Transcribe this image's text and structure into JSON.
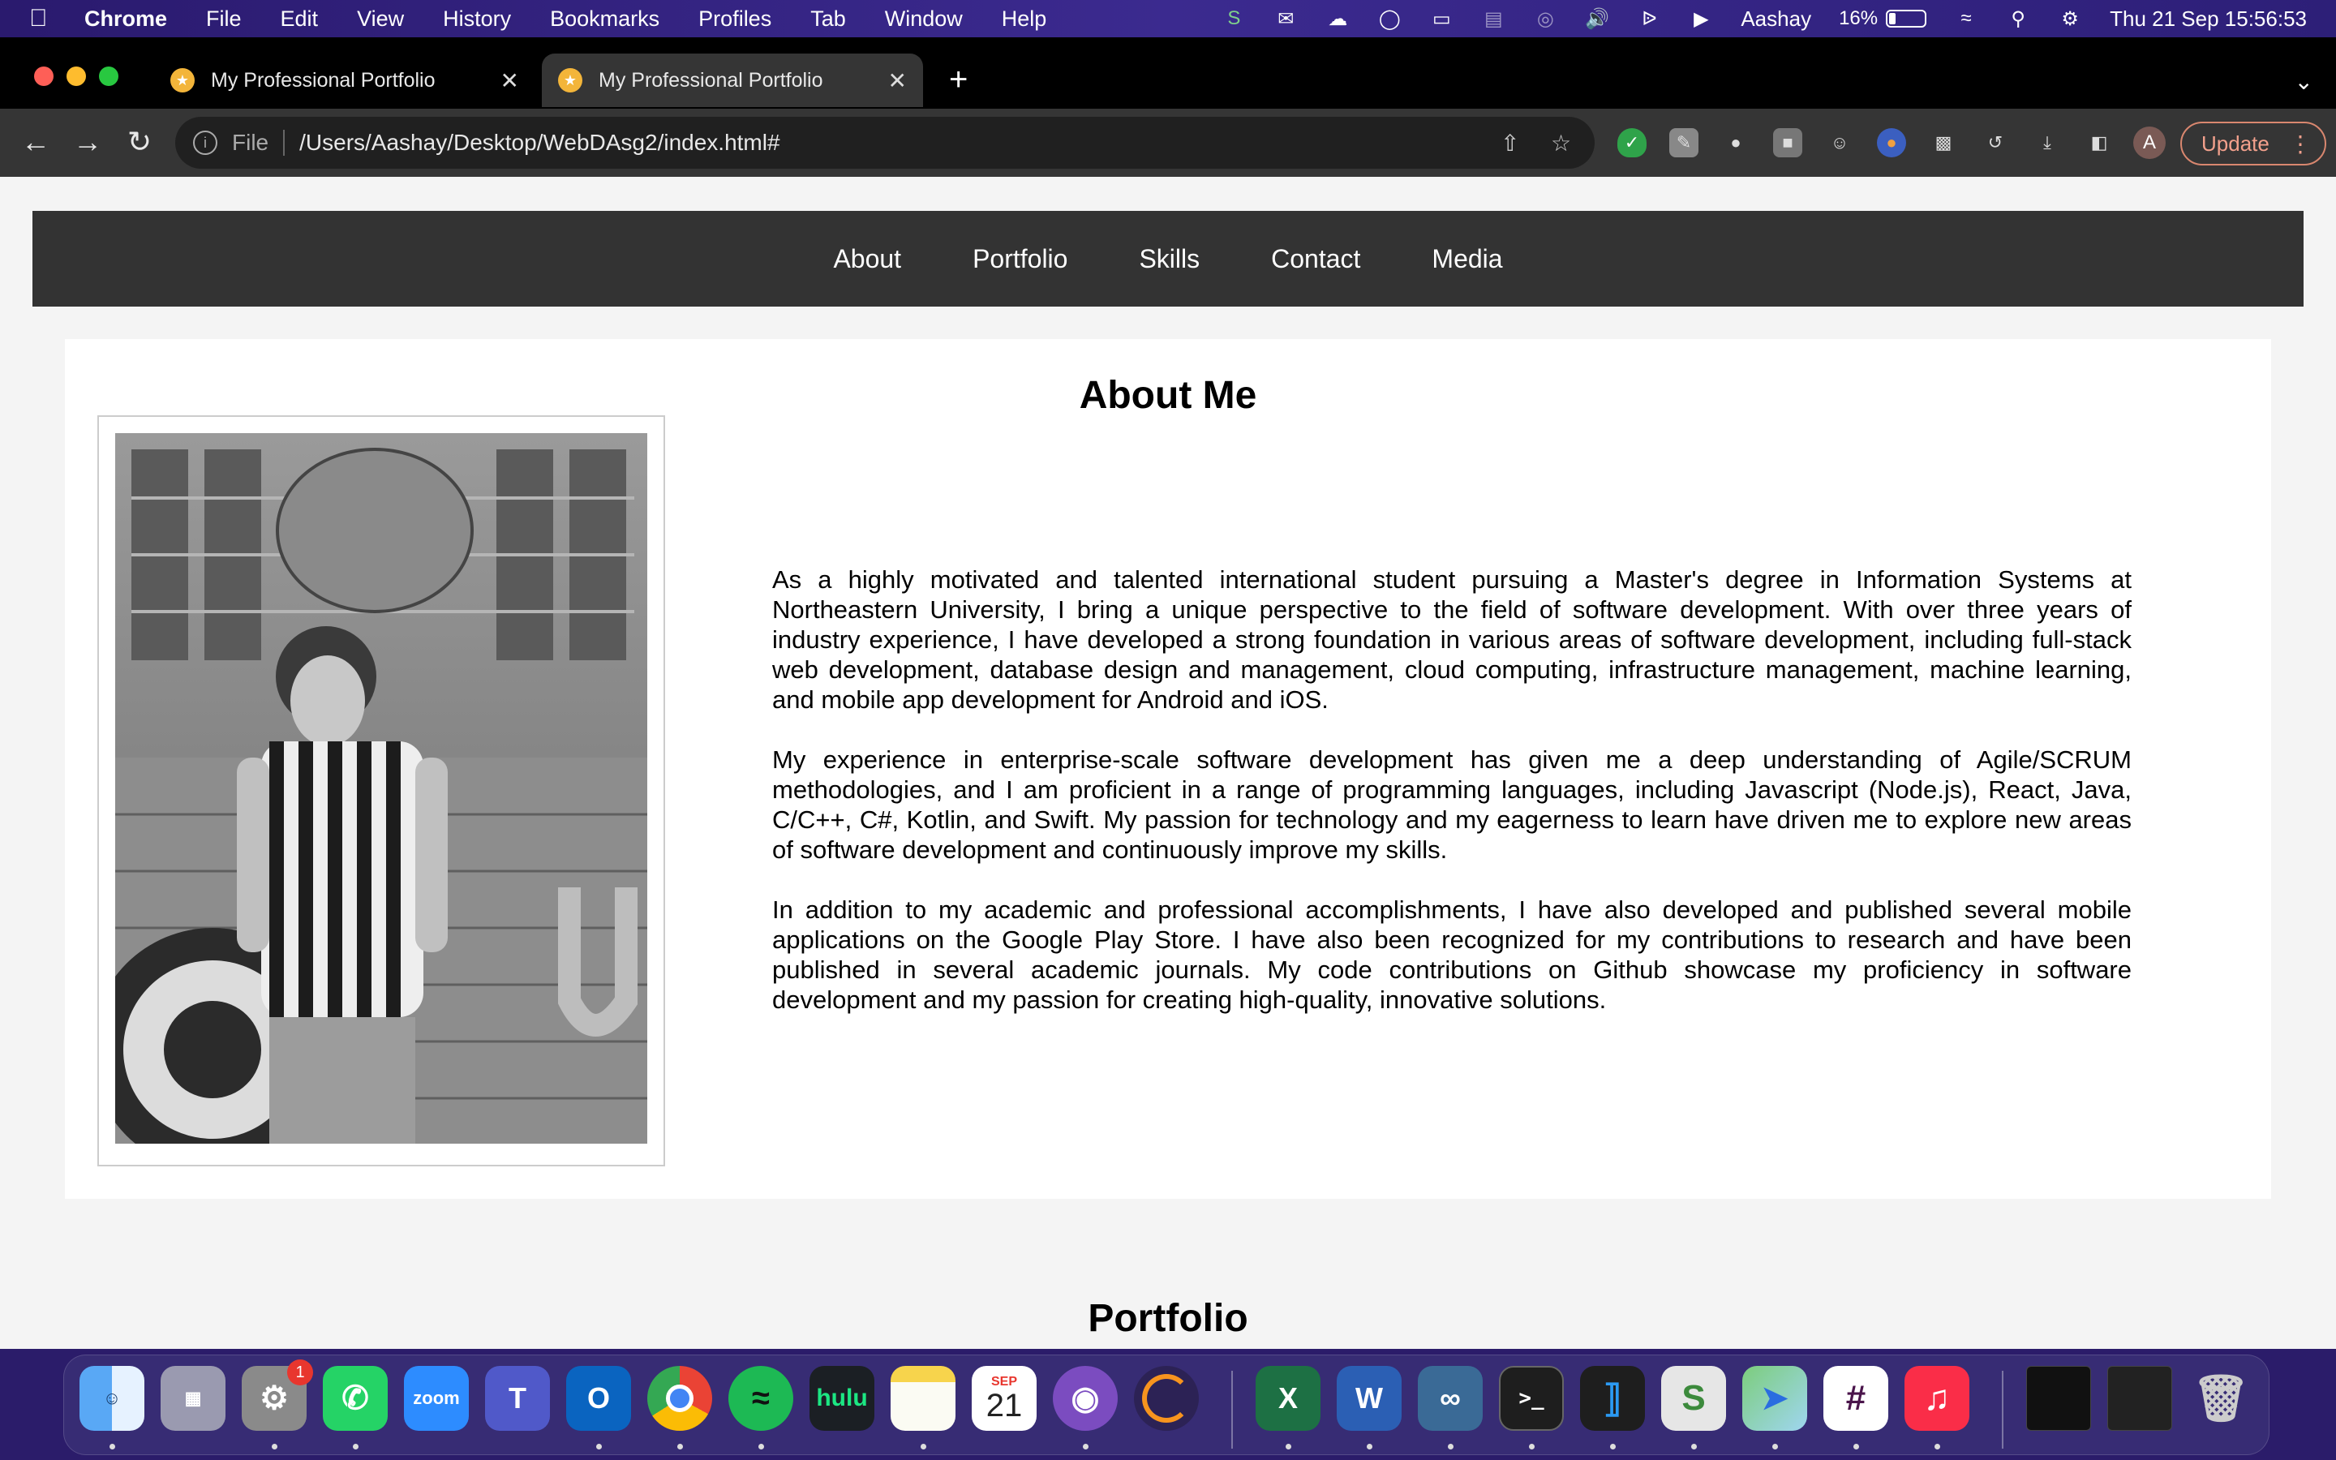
{
  "menubar": {
    "app_name": "Chrome",
    "items": [
      "File",
      "Edit",
      "View",
      "History",
      "Bookmarks",
      "Profiles",
      "Tab",
      "Window",
      "Help"
    ],
    "user": "Aashay",
    "battery": "16%",
    "datetime": "Thu 21 Sep  15:56:53"
  },
  "browser": {
    "tabs": [
      {
        "title": "My Professional Portfolio",
        "active": false
      },
      {
        "title": "My Professional Portfolio",
        "active": true
      }
    ],
    "omnibox": {
      "scheme": "File",
      "url": "/Users/Aashay/Desktop/WebDAsg2/index.html#"
    },
    "avatar_letter": "A",
    "update_label": "Update"
  },
  "page": {
    "nav": [
      "About",
      "Portfolio",
      "Skills",
      "Contact",
      "Media"
    ],
    "about": {
      "title": "About Me",
      "paragraphs": [
        "As a highly motivated and talented international student pursuing a Master's degree in Information Systems at Northeastern University, I bring a unique perspective to the field of software development. With over three years of industry experience, I have developed a strong foundation in various areas of software development, including full-stack web development, database design and management, cloud computing, infrastructure management, machine learning, and mobile app development for Android and iOS.",
        "My experience in enterprise-scale software development has given me a deep understanding of Agile/SCRUM methodologies, and I am proficient in a range of programming languages, including Javascript (Node.js), React, Java, C/C++, C#, Kotlin, and Swift. My passion for technology and my eagerness to learn have driven me to explore new areas of software development and continuously improve my skills.",
        "In addition to my academic and professional accomplishments, I have also developed and published several mobile applications on the Google Play Store. I have also been recognized for my contributions to research and have been published in several academic journals. My code contributions on Github showcase my proficiency in software development and my passion for creating high-quality, innovative solutions."
      ]
    },
    "portfolio_title": "Portfolio"
  },
  "dock": {
    "badge_count": "1",
    "calendar_month": "SEP",
    "calendar_day": "21",
    "zoom_label": "zoom",
    "hulu_label": "hulu"
  }
}
